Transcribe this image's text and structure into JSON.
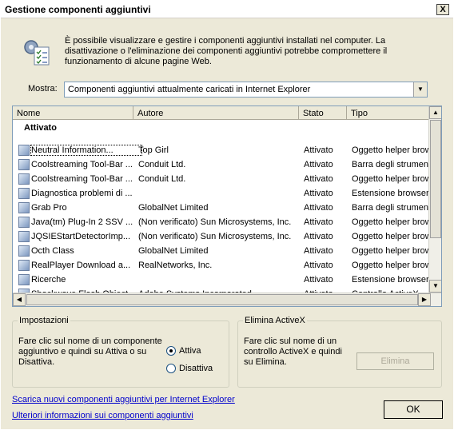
{
  "window": {
    "title": "Gestione componenti aggiuntivi",
    "close_glyph": "X"
  },
  "intro": {
    "text": "È possibile visualizzare e gestire i componenti aggiuntivi installati nel computer. La disattivazione o l'eliminazione dei componenti aggiuntivi potrebbe compromettere il funzionamento di alcune pagine Web."
  },
  "show": {
    "label": "Mostra:",
    "selected": "Componenti aggiuntivi attualmente caricati in Internet Explorer"
  },
  "list": {
    "columns": {
      "name": "Nome",
      "author": "Autore",
      "state": "Stato",
      "type": "Tipo"
    },
    "group": "Attivato",
    "rows": [
      {
        "name": "Neutral Information...",
        "author": "Top Girl",
        "state": "Attivato",
        "type": "Oggetto helper brow"
      },
      {
        "name": "Coolstreaming Tool-Bar ...",
        "author": "Conduit Ltd.",
        "state": "Attivato",
        "type": "Barra degli strument"
      },
      {
        "name": "Coolstreaming Tool-Bar ...",
        "author": "Conduit Ltd.",
        "state": "Attivato",
        "type": "Oggetto helper brow"
      },
      {
        "name": "Diagnostica problemi di ...",
        "author": "",
        "state": "Attivato",
        "type": "Estensione browser"
      },
      {
        "name": "Grab Pro",
        "author": "GlobalNet Limited",
        "state": "Attivato",
        "type": "Barra degli strument"
      },
      {
        "name": "Java(tm) Plug-In 2 SSV ...",
        "author": "(Non verificato) Sun Microsystems, Inc.",
        "state": "Attivato",
        "type": "Oggetto helper brow"
      },
      {
        "name": "JQSIEStartDetectorImp...",
        "author": "(Non verificato) Sun Microsystems, Inc.",
        "state": "Attivato",
        "type": "Oggetto helper brow"
      },
      {
        "name": "Octh Class",
        "author": "GlobalNet Limited",
        "state": "Attivato",
        "type": "Oggetto helper brow"
      },
      {
        "name": "RealPlayer Download a...",
        "author": "RealNetworks, Inc.",
        "state": "Attivato",
        "type": "Oggetto helper brow"
      },
      {
        "name": "Ricerche",
        "author": "",
        "state": "Attivato",
        "type": "Estensione browser"
      },
      {
        "name": "Shockwave Flash Object",
        "author": "Adobe Systems Incorporated",
        "state": "Attivato",
        "type": "Controllo ActiveX"
      }
    ]
  },
  "settings": {
    "legend": "Impostazioni",
    "text": "Fare clic sul nome di un componente aggiuntivo e quindi su Attiva o su Disattiva.",
    "enable_label": "Attiva",
    "disable_label": "Disattiva"
  },
  "activex": {
    "legend": "Elimina ActiveX",
    "text": "Fare clic sul nome di un controllo ActiveX e quindi su Elimina.",
    "delete_label": "Elimina"
  },
  "links": {
    "download": "Scarica nuovi componenti aggiuntivi per Internet Explorer",
    "info": "Ulteriori informazioni sui componenti aggiuntivi"
  },
  "ok_label": "OK",
  "icons": {
    "header": "addon-manager-icon",
    "row": "addon-icon"
  }
}
